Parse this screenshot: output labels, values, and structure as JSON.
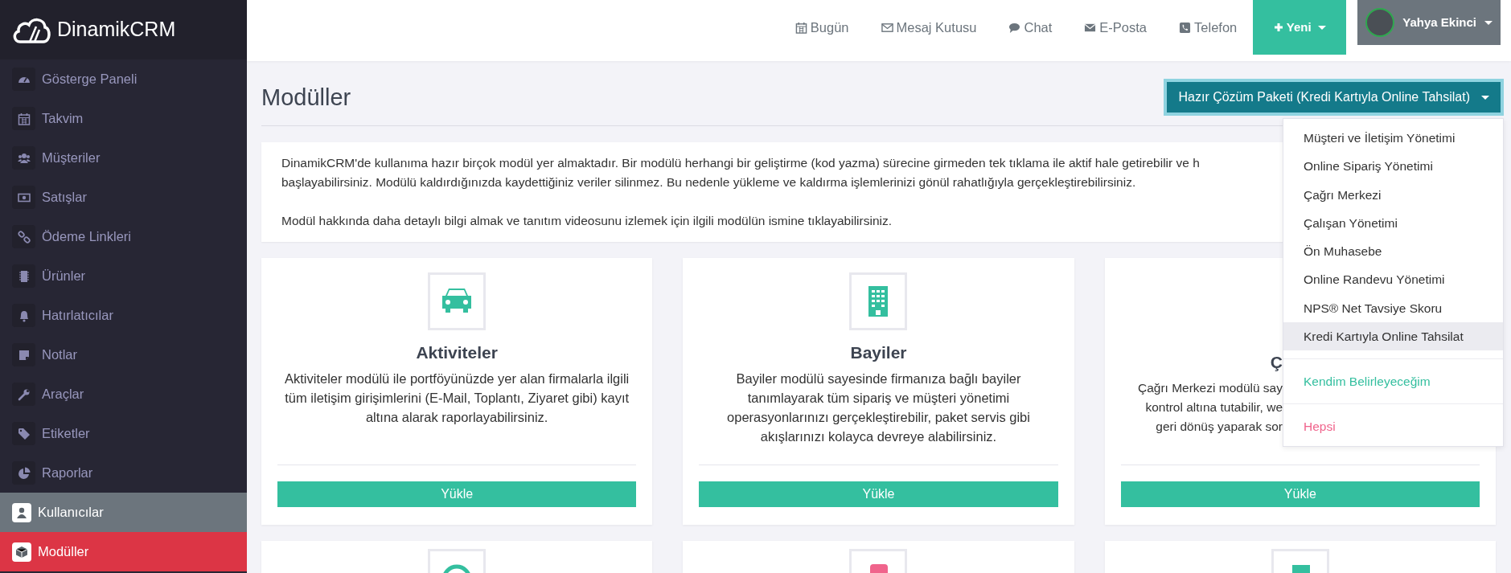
{
  "brand": {
    "name": "DinamikCRM"
  },
  "sidebar": {
    "items": [
      {
        "label": "Gösterge Paneli",
        "selected": false,
        "highlighted": false
      },
      {
        "label": "Takvim",
        "selected": false,
        "highlighted": false
      },
      {
        "label": "Müşteriler",
        "selected": false,
        "highlighted": false
      },
      {
        "label": "Satışlar",
        "selected": false,
        "highlighted": false
      },
      {
        "label": "Ödeme Linkleri",
        "selected": false,
        "highlighted": false
      },
      {
        "label": "Ürünler",
        "selected": false,
        "highlighted": false
      },
      {
        "label": "Hatırlatıcılar",
        "selected": false,
        "highlighted": false
      },
      {
        "label": "Notlar",
        "selected": false,
        "highlighted": false
      },
      {
        "label": "Araçlar",
        "selected": false,
        "highlighted": false
      },
      {
        "label": "Etiketler",
        "selected": false,
        "highlighted": false
      },
      {
        "label": "Raporlar",
        "selected": false,
        "highlighted": false
      },
      {
        "label": "Kullanıcılar",
        "selected": false,
        "highlighted": true
      },
      {
        "label": "Modüller",
        "selected": true,
        "highlighted": false
      }
    ]
  },
  "topbar": {
    "links": [
      "Bugün",
      "Mesaj Kutusu",
      "Chat",
      "E-Posta",
      "Telefon"
    ],
    "new_button": "Yeni",
    "user": {
      "name": "Yahya Ekinci"
    }
  },
  "page": {
    "title": "Modüller",
    "package_button": "Hazır Çözüm Paketi (Kredi Kartıyla Online Tahsilat)"
  },
  "package_menu": {
    "items": [
      {
        "label": "Müşteri ve İletişim Yönetimi",
        "selected": false
      },
      {
        "label": "Online Sipariş Yönetimi",
        "selected": false
      },
      {
        "label": "Çağrı Merkezi",
        "selected": false
      },
      {
        "label": "Çalışan Yönetimi",
        "selected": false
      },
      {
        "label": "Ön Muhasebe",
        "selected": false
      },
      {
        "label": "Online Randevu Yönetimi",
        "selected": false
      },
      {
        "label": "NPS® Net Tavsiye Skoru",
        "selected": false
      },
      {
        "label": "Kredi Kartıyla Online Tahsilat",
        "selected": true
      }
    ],
    "extra_options": [
      {
        "label": "Kendim Belirleyeceğim",
        "color": "#34bf9f"
      },
      {
        "label": "Hepsi",
        "color": "#f0648c"
      }
    ]
  },
  "intro": {
    "lines": [
      "DinamikCRM'de kullanıma hazır birçok modül yer almaktadır. Bir modülü herhangi bir geliştirme (kod yazma) sürecine girmeden tek tıklama ile aktif hale getirebilir ve h",
      "başlayabilirsiniz. Modülü kaldırdığınızda kaydettiğiniz veriler silinmez. Bu nedenle yükleme ve kaldırma işlemlerinizi gönül rahatlığıyla gerçekleştirebilirsiniz."
    ],
    "note": "Modül hakkında daha detaylı bilgi almak ve tanıtım videosunu izlemek için ilgili modülün ismine tıklayabilirsiniz."
  },
  "modules": [
    {
      "kind": "full",
      "title": "Aktiviteler",
      "description": "Aktiviteler modülü ile portföyünüzde yer alan firmalarla ilgili tüm iletişim girişimlerini (E-Mail, Toplantı, Ziyaret gibi) kayıt altına alarak raporlayabilirsiniz.",
      "button": "Yükle"
    },
    {
      "kind": "full",
      "title": "Bayiler",
      "description": "Bayiler modülü sayesinde firmanıza bağlı bayiler tanımlayarak tüm sipariş ve müşteri yönetimi operasyonlarınızı gerçekleştirebilir, paket servis gibi akışlarınızı kolayca devreye alabilirsiniz.",
      "button": "Yükle"
    },
    {
      "kind": "covered",
      "title": "Ç",
      "description_lines": [
        "Çağrı Merkezi modülü say",
        "kontrol altına tutabilir, we",
        "geri dönüş yaparak sor"
      ],
      "button": "Yükle"
    }
  ]
}
